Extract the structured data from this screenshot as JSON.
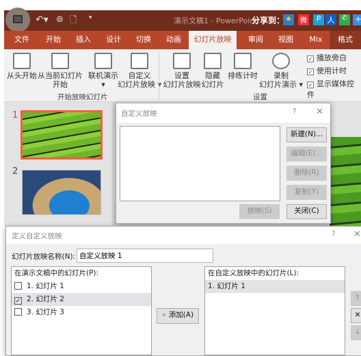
{
  "titlebar": {
    "title": "演示文稿1 - PowerPoint",
    "share_label": "分享到："
  },
  "tabs": [
    {
      "label": "文件"
    },
    {
      "label": "开始"
    },
    {
      "label": "插入"
    },
    {
      "label": "设计"
    },
    {
      "label": "切换"
    },
    {
      "label": "动画"
    },
    {
      "label": "幻灯片放映",
      "active": true
    },
    {
      "label": "审阅"
    },
    {
      "label": "视图"
    },
    {
      "label": "Mix"
    },
    {
      "label": "格式"
    }
  ],
  "ribbon": {
    "buttons": [
      {
        "label": "从头开始"
      },
      {
        "label": "从当前幻灯片\n开始"
      },
      {
        "label": "联机演示\n▾"
      },
      {
        "label": "自定义\n幻灯片放映 ▾"
      },
      {
        "label": "设置\n幻灯片放映"
      },
      {
        "label": "隐藏\n幻灯片"
      },
      {
        "label": "排练计时"
      },
      {
        "label": "录制\n幻灯片演示 ▾"
      }
    ],
    "checkboxes": [
      {
        "label": "播放旁白",
        "checked": true
      },
      {
        "label": "使用计时",
        "checked": true
      },
      {
        "label": "显示媒体控件",
        "checked": true
      }
    ],
    "groups": {
      "start": "开始放映幻灯片",
      "setup": "设置"
    }
  },
  "slides": [
    {
      "number": "1",
      "selected": true
    },
    {
      "number": "2"
    }
  ],
  "custom_show_dialog": {
    "title": "自定义放映",
    "help": "?",
    "close": "✕",
    "buttons": {
      "new": "新建(N)...",
      "edit": "编辑(E)...",
      "delete": "删除(R)",
      "copy": "复制(Y)",
      "show": "放映(S)",
      "close": "关闭(C)"
    }
  },
  "define_dialog": {
    "title": "定义自定义放映",
    "help": "?",
    "close": "✕",
    "name_label": "幻灯片放映名称(N):",
    "name_value": "自定义放映 1",
    "left_header": "在演示文稿中的幻灯片(P):",
    "left_items": [
      {
        "label": "1. 幻灯片 1",
        "checked": false
      },
      {
        "label": "2. 幻灯片 2",
        "checked": true
      },
      {
        "label": "3. 幻灯片 3",
        "checked": false
      }
    ],
    "add_label": "添加(A)",
    "right_header": "在自定义放映中的幻灯片(L):",
    "right_items": [
      {
        "label": "1. 幻灯片 1"
      }
    ]
  },
  "colors": {
    "accent": "#b7472a",
    "titlebar": "#6e2c1d",
    "selection": "#f0623f"
  }
}
